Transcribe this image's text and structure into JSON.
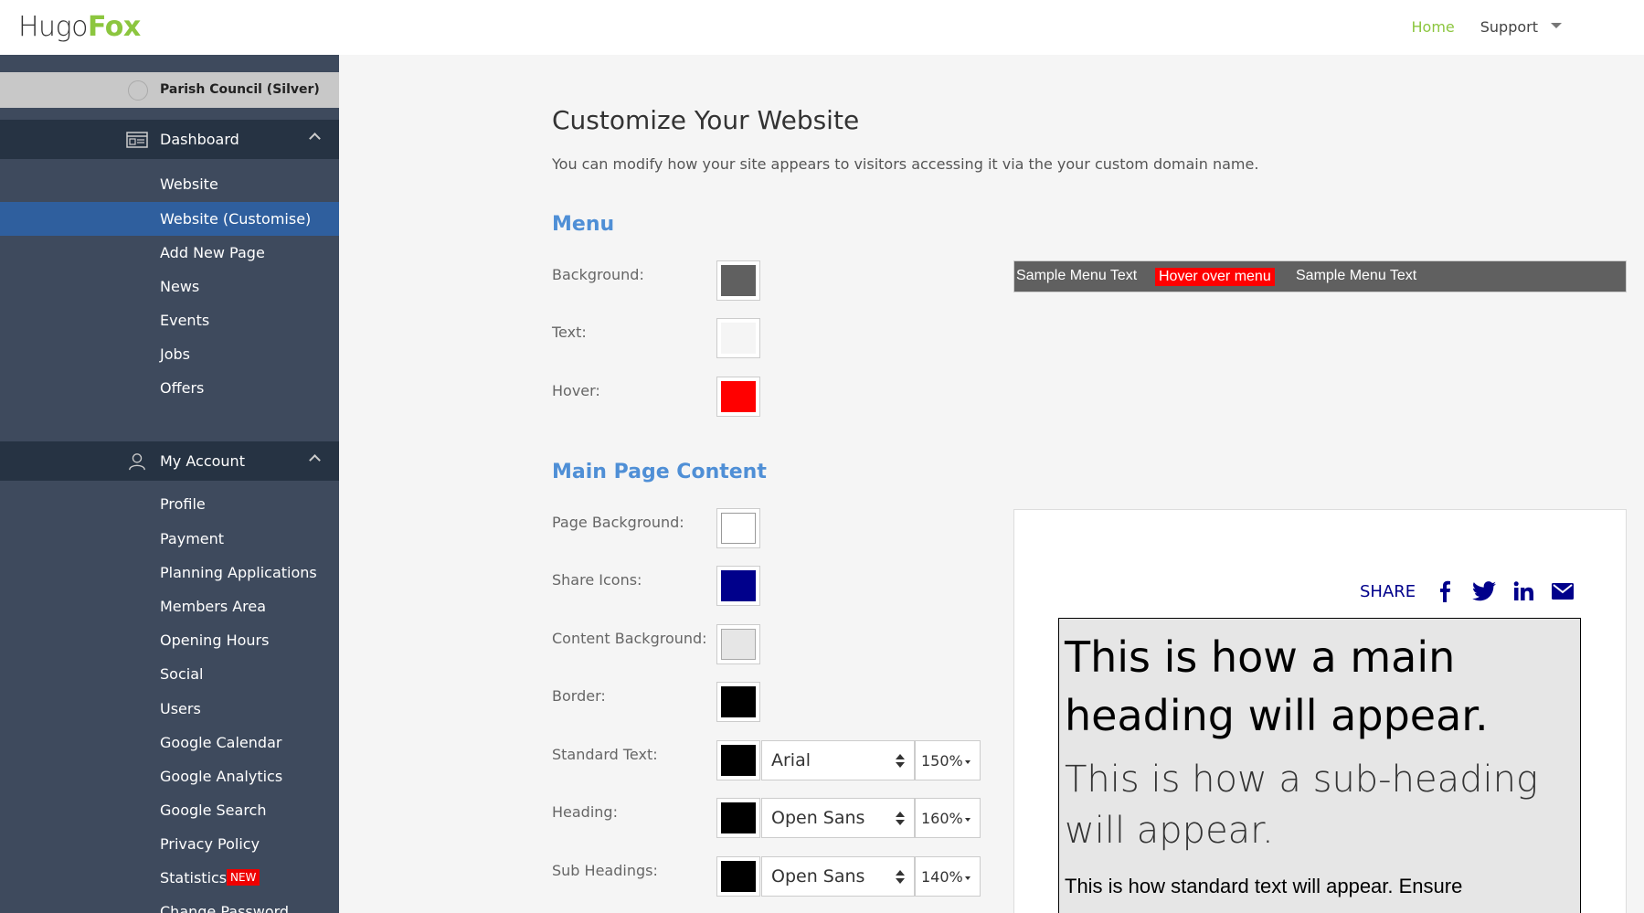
{
  "header": {
    "logo_part1": "Hugo",
    "logo_part2": "Fox",
    "nav_home": "Home",
    "nav_support": "Support"
  },
  "sidebar": {
    "plan": "Parish Council (Silver)",
    "dashboard": {
      "label": "Dashboard",
      "items": [
        "Website",
        "Website (Customise)",
        "Add New Page",
        "News",
        "Events",
        "Jobs",
        "Offers"
      ]
    },
    "account": {
      "label": "My Account",
      "items": [
        "Profile",
        "Payment",
        "Planning Applications",
        "Members Area",
        "Opening Hours",
        "Social",
        "Users",
        "Google Calendar",
        "Google Analytics",
        "Google Search",
        "Privacy Policy",
        "Statistics",
        "Change Password"
      ]
    },
    "new_badge": "NEW"
  },
  "main": {
    "title": "Customize Your Website",
    "description": "You can modify how your site appears to visitors accessing it via the your custom domain name.",
    "menu_section": {
      "title": "Menu",
      "background_label": "Background:",
      "text_label": "Text:",
      "hover_label": "Hover:"
    },
    "content_section": {
      "title": "Main Page Content",
      "page_bg_label": "Page Background:",
      "share_icons_label": "Share Icons:",
      "content_bg_label": "Content Background:",
      "border_label": "Border:",
      "standard_text_label": "Standard Text:",
      "heading_label": "Heading:",
      "sub_headings_label": "Sub Headings:",
      "standard_font": "Arial",
      "standard_size": "150%",
      "heading_font": "Open Sans",
      "heading_size": "160%",
      "sub_font": "Open Sans",
      "sub_size": "140%"
    }
  },
  "colors": {
    "menu_background": "#606060",
    "menu_text": "#f5f5f5",
    "menu_hover": "#ff0000",
    "page_background": "#ffffff",
    "share_icons": "#00008b",
    "content_background": "#e6e6e6",
    "border": "#000000",
    "standard_text": "#000000",
    "heading": "#000000",
    "sub_headings": "#000000"
  },
  "preview": {
    "menu_item_1": "Sample Menu Text",
    "menu_hover_item": "Hover over menu",
    "menu_item_2": "Sample Menu Text",
    "share_label": "SHARE",
    "share_icons": [
      "facebook-icon",
      "twitter-icon",
      "linkedin-icon",
      "email-icon"
    ],
    "main_heading": "This is how a main heading will appear.",
    "sub_heading": "This is how a sub-heading will appear.",
    "standard_text": "This is how standard text will appear. Ensure"
  }
}
